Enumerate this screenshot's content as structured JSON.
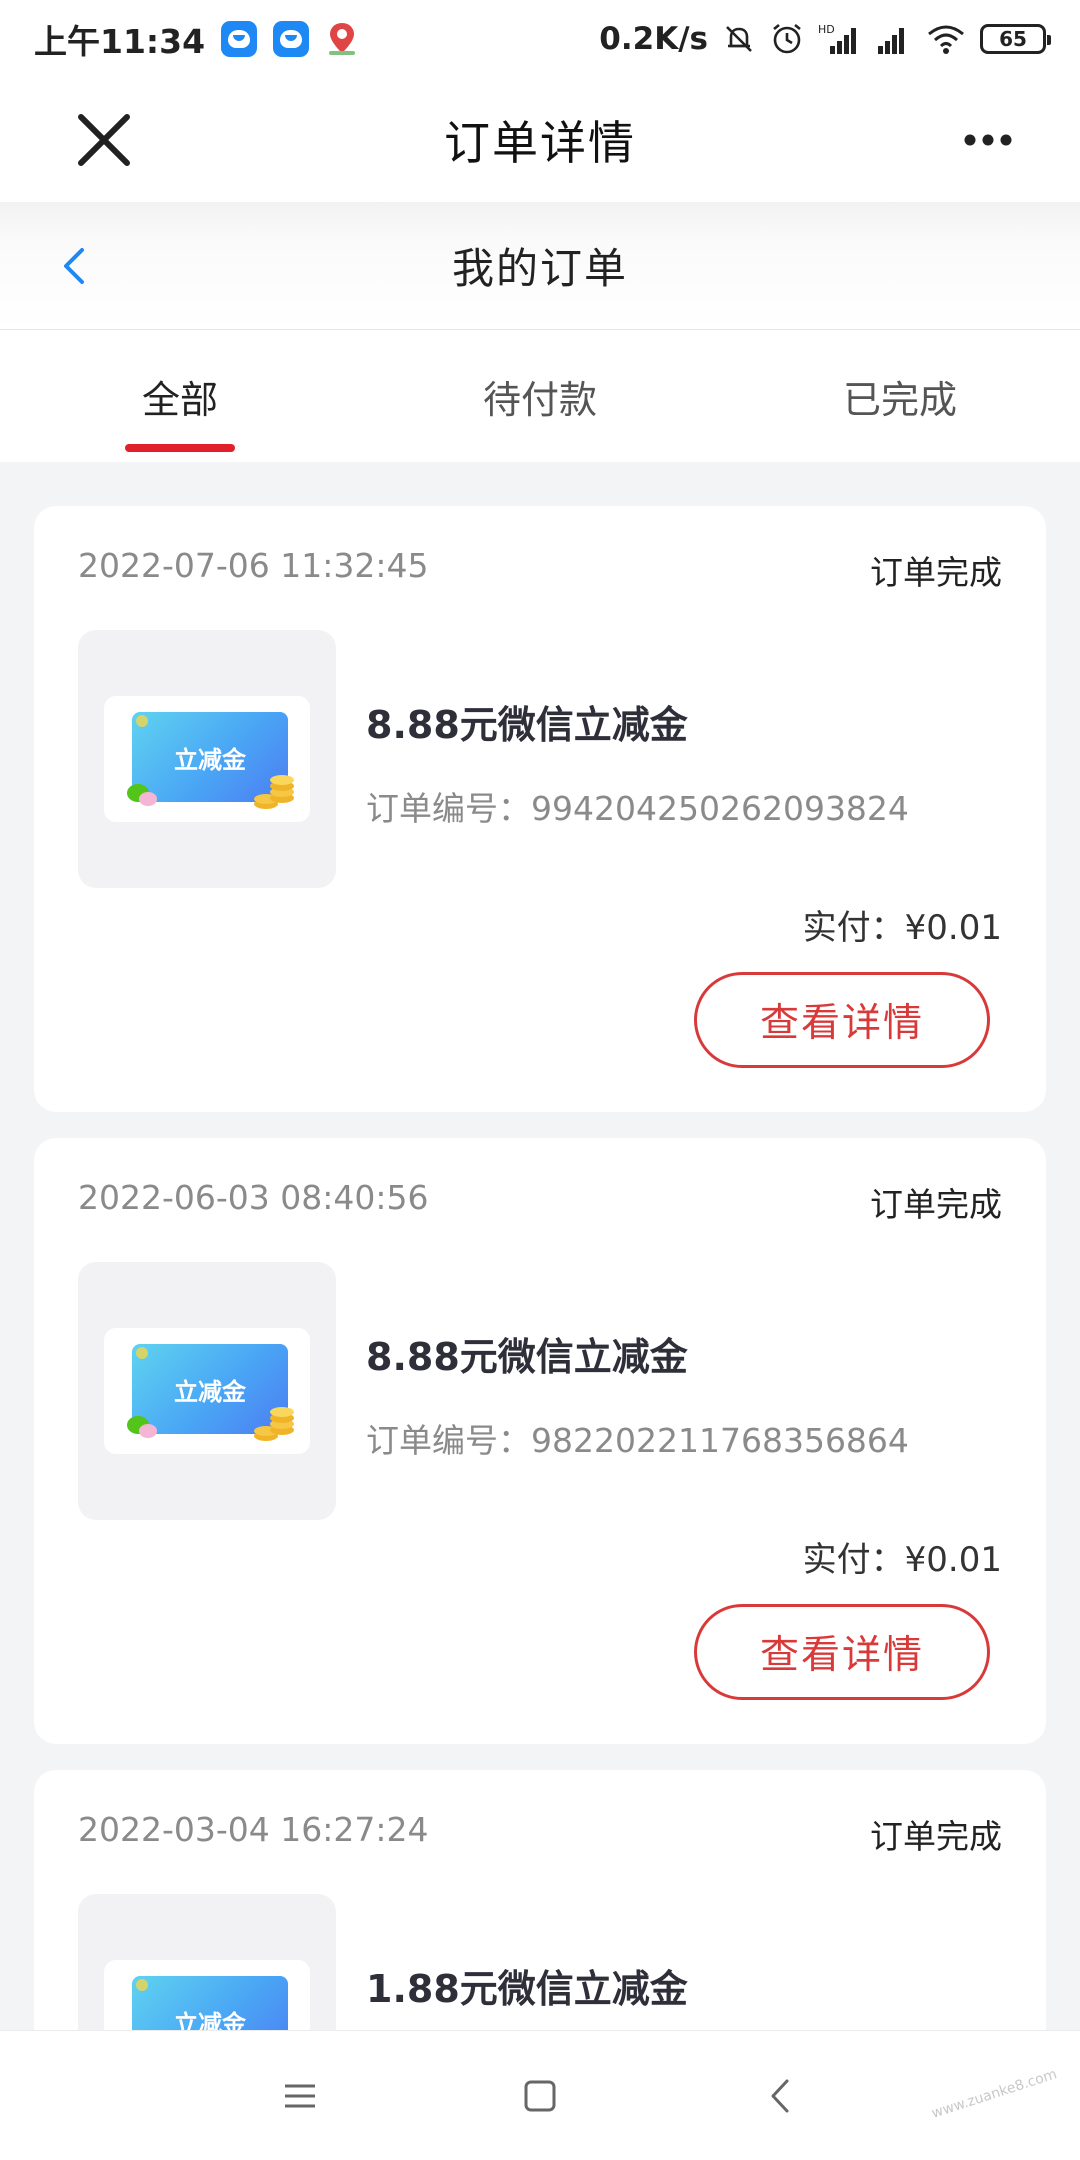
{
  "status_bar": {
    "time": "上午11:34",
    "speed": "0.2K/s",
    "battery": "65",
    "icons": [
      "app-badge-icon",
      "app-badge-icon",
      "map-pin-icon",
      "bell-off-icon",
      "alarm-icon",
      "signal-hd-icon",
      "signal-icon",
      "wifi-icon",
      "battery-icon"
    ]
  },
  "title_bar": {
    "title": "订单详情",
    "close_icon": "close-icon",
    "more_icon": "more-dots-icon"
  },
  "sub_header": {
    "title": "我的订单",
    "back_icon": "chevron-left-icon"
  },
  "tabs": [
    {
      "label": "全部",
      "active": true
    },
    {
      "label": "待付款",
      "active": false
    },
    {
      "label": "已完成",
      "active": false
    }
  ],
  "orders": [
    {
      "time": "2022-07-06 11:32:45",
      "status": "订单完成",
      "coupon_text": "立减金",
      "name": "8.88元微信立减金",
      "order_no": "订单编号：994204250262093824",
      "paid": "实付：¥0.01",
      "button": "查看详情"
    },
    {
      "time": "2022-06-03 08:40:56",
      "status": "订单完成",
      "coupon_text": "立减金",
      "name": "8.88元微信立减金",
      "order_no": "订单编号：982202211768356864",
      "paid": "实付：¥0.01",
      "button": "查看详情"
    },
    {
      "time": "2022-03-04 16:27:24",
      "status": "订单完成",
      "coupon_text": "立减金",
      "name": "1.88元微信立减金"
    }
  ],
  "bottom_nav": {
    "icons": [
      "menu-icon",
      "home-square-icon",
      "back-chevron-icon"
    ]
  },
  "watermark": "www.zuanke8.com",
  "colors": {
    "accent_red": "#d83a3a",
    "tab_underline": "#e0202a",
    "back_blue": "#1e88f5"
  }
}
